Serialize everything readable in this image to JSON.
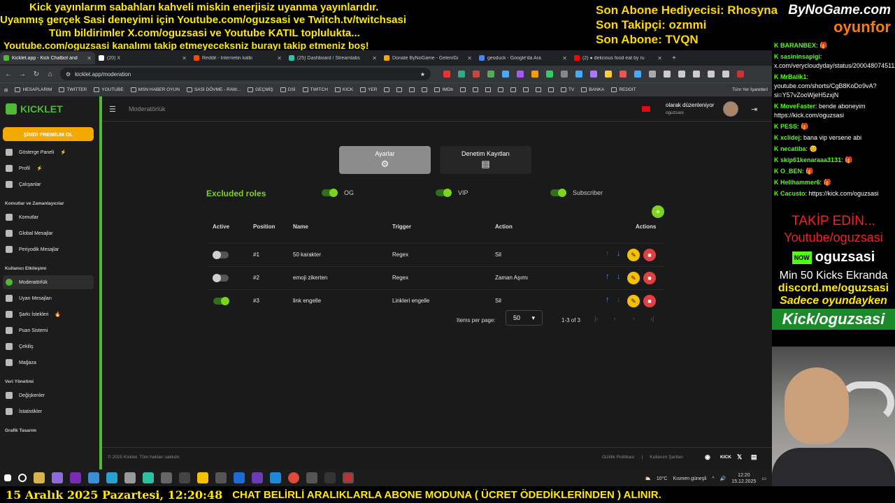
{
  "overlay": {
    "line1": "Kick yayınlarım sabahları kahveli miskin enerjisiz uyanma yayınlarıdır.",
    "line2": "Uyanmış gerçek Sasi deneyimi için Youtube.com/oguzsasi ve Twitch.tv/twitchsasi",
    "line3": "Tüm bildirimler X.com/oguzsasi ve Youtube KATIL toplulukta...",
    "line4": "Youtube.com/oguzsasi kanalımı takip etmeyeceksniz burayı takip etmeniz boş!",
    "sub_gift": "Son Abone Hediyecisi: Rhosyna",
    "sub_follow": "Son Takipçi: ozmmi",
    "sub_sub": "Son Abone: TVQN",
    "brand_top": "ByNoGame.com",
    "brand_bottom": "oyunfor"
  },
  "browser": {
    "tabs": [
      {
        "label": "Kicklet.app - Kick Chatbot and",
        "color": "#53b83a",
        "active": true
      },
      {
        "label": "(20) X",
        "color": "#ffffff",
        "active": false
      },
      {
        "label": "Reddit - İnternetin kalbi",
        "color": "#ff4500",
        "active": false
      },
      {
        "label": "(25) Dashboard / Streamlabs",
        "color": "#31c3a2",
        "active": false
      },
      {
        "label": "Donate ByNoGame - Gelen/Gi",
        "color": "#f5a800",
        "active": false
      },
      {
        "label": "geoduck - Google'da Ara",
        "color": "#4285f4",
        "active": false
      },
      {
        "label": "(2) ● delicious food eat by ru",
        "color": "#ff0000",
        "active": false
      }
    ],
    "new_tab": "+",
    "url": "kicklet.app/moderation",
    "bookmarks": [
      "HESAPLARIM",
      "TWITTER",
      "YOUTUBE",
      "MSN HABER OYUN",
      "SASİ DÖVME - RAW...",
      "GEÇMİŞ",
      "DSİ",
      "TWITCH",
      "KICK",
      "YER",
      "",
      "",
      "",
      "",
      "IMDb",
      "",
      "",
      "",
      "",
      "",
      "",
      "",
      "",
      "TV",
      "BANKA",
      "REDDIT"
    ],
    "all_bookmarks": "Tüm Yer İşaretleri"
  },
  "app": {
    "logo": "KICKLET",
    "premium": "ŞİMDİ PREMİUM OL",
    "sidebar": [
      {
        "type": "item",
        "label": "Gösterge Paneli",
        "badge": "⚡"
      },
      {
        "type": "item",
        "label": "Profil",
        "badge": "⚡"
      },
      {
        "type": "item",
        "label": "Çalışanlar",
        "badge": ""
      },
      {
        "type": "sec",
        "label": "Komutlar ve Zamanlayıcılar"
      },
      {
        "type": "item",
        "label": "Komutlar",
        "badge": ""
      },
      {
        "type": "item",
        "label": "Global Mesajlar",
        "badge": ""
      },
      {
        "type": "item",
        "label": "Periyodik Mesajlar",
        "badge": ""
      },
      {
        "type": "sec",
        "label": "Kullanıcı Etkileşimi"
      },
      {
        "type": "item",
        "label": "Moderatörlük",
        "badge": "",
        "selected": true
      },
      {
        "type": "item",
        "label": "Uyarı Mesajları",
        "badge": ""
      },
      {
        "type": "item",
        "label": "Şarkı İstekleri",
        "badge": "🔥"
      },
      {
        "type": "item",
        "label": "Puan Sistemi",
        "badge": ""
      },
      {
        "type": "item",
        "label": "Çekiliş",
        "badge": ""
      },
      {
        "type": "item",
        "label": "Mağaza",
        "badge": ""
      },
      {
        "type": "sec",
        "label": "Veri Yönetimi"
      },
      {
        "type": "item",
        "label": "Değişkenler",
        "badge": ""
      },
      {
        "type": "item",
        "label": "İstatistikler",
        "badge": ""
      },
      {
        "type": "sec",
        "label": "Grafik Tasarım"
      }
    ],
    "page_title": "Moderatörlük",
    "user_line1": "olarak düzenleniyor",
    "user_line2": "oguzsasi",
    "tab_settings": "Ayarlar",
    "tab_audit": "Denetim Kayıtları",
    "excluded_roles": "Excluded roles",
    "roles": [
      {
        "label": "OG",
        "on": true
      },
      {
        "label": "VIP",
        "on": true
      },
      {
        "label": "Subscriber",
        "on": true
      }
    ],
    "headers": {
      "active": "Active",
      "position": "Position",
      "name": "Name",
      "trigger": "Trigger",
      "action": "Action",
      "actions": "Actions"
    },
    "rows": [
      {
        "active": false,
        "position": "#1",
        "name": "50 karakter",
        "trigger": "Regex",
        "action": "Sil",
        "up": false,
        "down": true
      },
      {
        "active": false,
        "position": "#2",
        "name": "emoji zikerten",
        "trigger": "Regex",
        "action": "Zaman Aşımı",
        "up": true,
        "down": true
      },
      {
        "active": true,
        "position": "#3",
        "name": "link engelle",
        "trigger": "Linkleri engelle",
        "action": "Sil",
        "up": true,
        "down": false
      }
    ],
    "items_per_page_label": "Items per page:",
    "items_per_page": "50",
    "range": "1-3 of 3",
    "footer_copy": "© 2025 Kicklet. Tüm hakları saklıdır.",
    "footer_privacy": "Gizlilik Politikası",
    "footer_terms": "Kullanım Şartları",
    "footer_kick": "KICK"
  },
  "taskbar": {
    "weather": "10°C",
    "weather_desc": "Kısmen güneşli",
    "time": "12:20",
    "date": "15.12.2025"
  },
  "ticker": {
    "date": "15 Aralık 2025 Pazartesi, 12:20:48",
    "message": "CHAT BELİRLİ ARALIKLARLA ABONE MODUNA ( ÜCRET ÖDEDİKLERİNDEN ) ALINIR."
  },
  "chat": [
    {
      "user": "BARANBEX",
      "text": ": 🎁"
    },
    {
      "user": "sasininsapigi",
      "text": ": x.com/verycloudyday/status/2000480745111036162"
    },
    {
      "user": "MrBalik1",
      "text": ": youtube.com/shorts/CgB8KoDo9vA?si=Y57vZooWjeH5zxjN"
    },
    {
      "user": "MoveFaster",
      "text": ": bende aboneyim https://kick.com/oguzsasi"
    },
    {
      "user": "PESS",
      "text": ": 🎁"
    },
    {
      "user": "xclidej",
      "text": ": bana vip versene abi"
    },
    {
      "user": "necatiba",
      "text": ": 😊"
    },
    {
      "user": "skip61kenaraaa3131",
      "text": ": 🎁"
    },
    {
      "user": "O_BEN",
      "text": ": 🎁"
    },
    {
      "user": "Hellhammer6",
      "text": ": 🎁"
    },
    {
      "user": "Cacusto",
      "text": ": https://kick.com/oguzsasi"
    }
  ],
  "promo": {
    "l1": "TAKİP EDİN...",
    "l2": "Youtube/oguzsasi",
    "now": "NOW",
    "l3": "oguzsasi",
    "l4": "Min 50 Kicks Ekranda",
    "l5": "discord.me/oguzsasi",
    "l6": "Sadece oyundayken",
    "l7": "Kick/oguzsasi"
  }
}
